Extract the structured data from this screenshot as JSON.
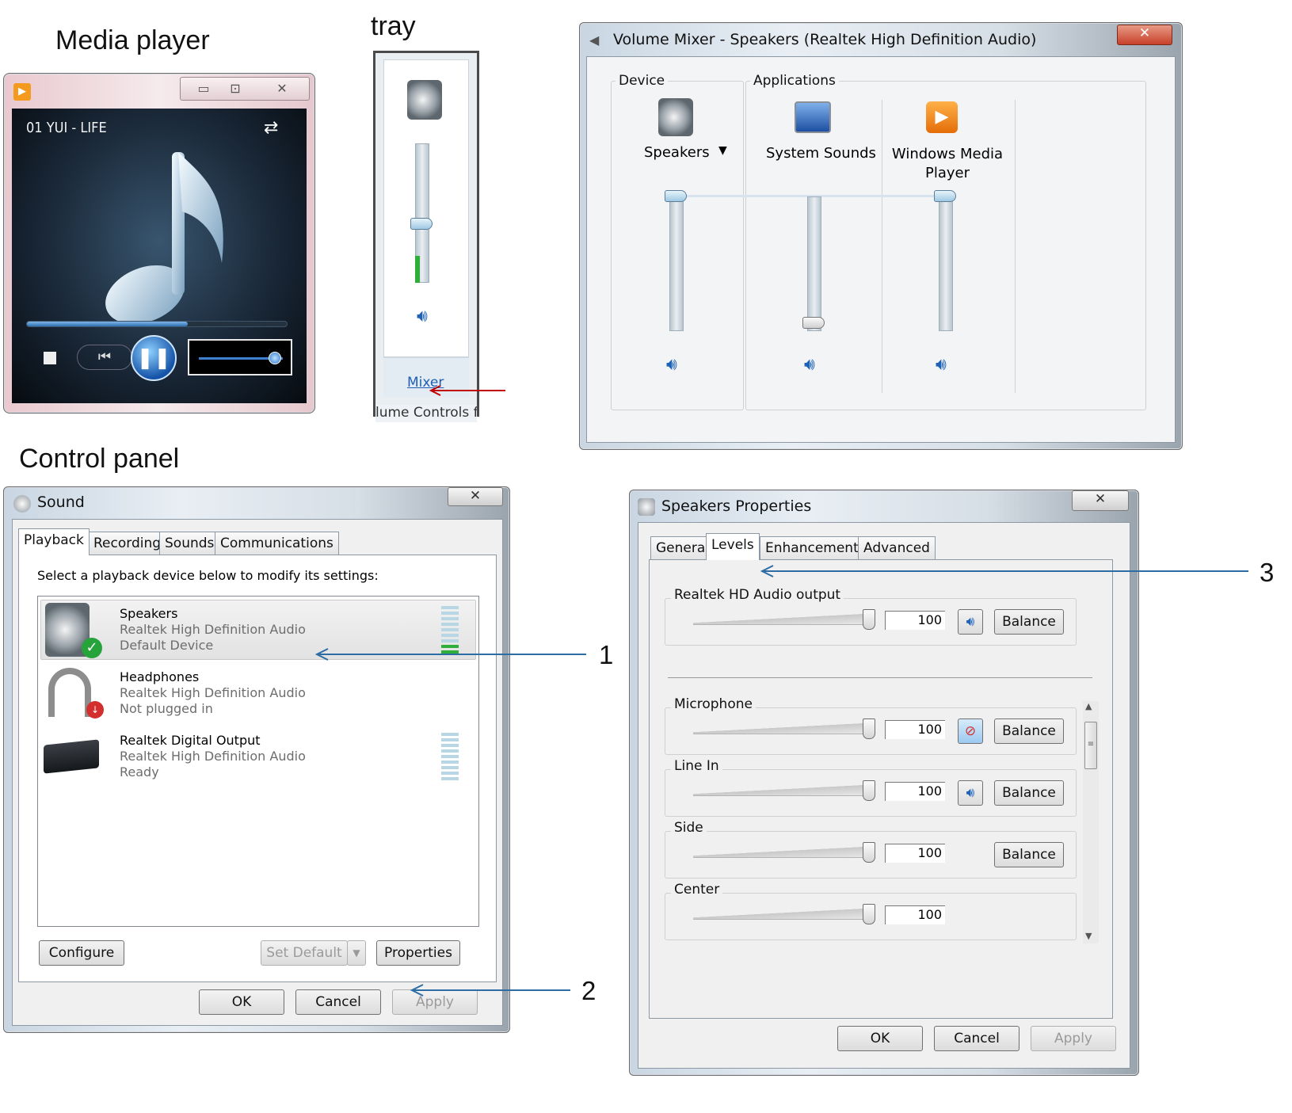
{
  "captions": {
    "media_player": "Media player",
    "tray": "tray",
    "control_panel": "Control panel"
  },
  "media_player": {
    "track": "01 YUI - LIFE",
    "progress": 0.62,
    "volume": 0.96,
    "buttons": {
      "minimize": "▭",
      "restore": "⊡",
      "close": "✕"
    }
  },
  "tray": {
    "mixer_link": "Mixer",
    "footer_text": "lume Controls fo",
    "level": 0.55
  },
  "volume_mixer": {
    "title": "Volume Mixer - Speakers (Realtek High Definition Audio)",
    "device_label": "Device",
    "applications_label": "Applications",
    "device_name": "Speakers",
    "apps": [
      {
        "name": "System Sounds",
        "level": 0.05
      },
      {
        "name": "Windows Media Player",
        "level": 1.0
      }
    ],
    "device_level": 1.0,
    "close": "✕"
  },
  "sound_dialog": {
    "title": "Sound",
    "tabs": [
      "Playback",
      "Recording",
      "Sounds",
      "Communications"
    ],
    "instruction": "Select a playback device below to modify its settings:",
    "devices": [
      {
        "name": "Speakers",
        "driver": "Realtek High Definition Audio",
        "status": "Default Device"
      },
      {
        "name": "Headphones",
        "driver": "Realtek High Definition Audio",
        "status": "Not plugged in"
      },
      {
        "name": "Realtek Digital Output",
        "driver": "Realtek High Definition Audio",
        "status": "Ready"
      }
    ],
    "buttons": {
      "configure": "Configure",
      "set_default": "Set Default",
      "properties": "Properties",
      "ok": "OK",
      "cancel": "Cancel",
      "apply": "Apply"
    },
    "close": "✕"
  },
  "speakers_properties": {
    "title": "Speakers Properties",
    "tabs": [
      "General",
      "Levels",
      "Enhancements",
      "Advanced"
    ],
    "levels": [
      {
        "label": "Realtek HD Audio output",
        "value": "100",
        "has_mute": true,
        "muted": false,
        "has_balance": true
      },
      {
        "label": "Microphone",
        "value": "100",
        "has_mute": true,
        "muted": true,
        "has_balance": true
      },
      {
        "label": "Line In",
        "value": "100",
        "has_mute": true,
        "muted": false,
        "has_balance": true
      },
      {
        "label": "Side",
        "value": "100",
        "has_mute": false,
        "muted": false,
        "has_balance": true
      },
      {
        "label": "Center",
        "value": "100",
        "has_mute": false,
        "muted": false,
        "has_balance": false
      }
    ],
    "balance_label": "Balance",
    "buttons": {
      "ok": "OK",
      "cancel": "Cancel",
      "apply": "Apply"
    },
    "close": "✕"
  },
  "annotations": [
    "1",
    "2",
    "3"
  ],
  "colors": {
    "annotation_line": "#2e6da4",
    "tray_arrow": "#c00000",
    "accent_blue": "#1e62b5"
  }
}
